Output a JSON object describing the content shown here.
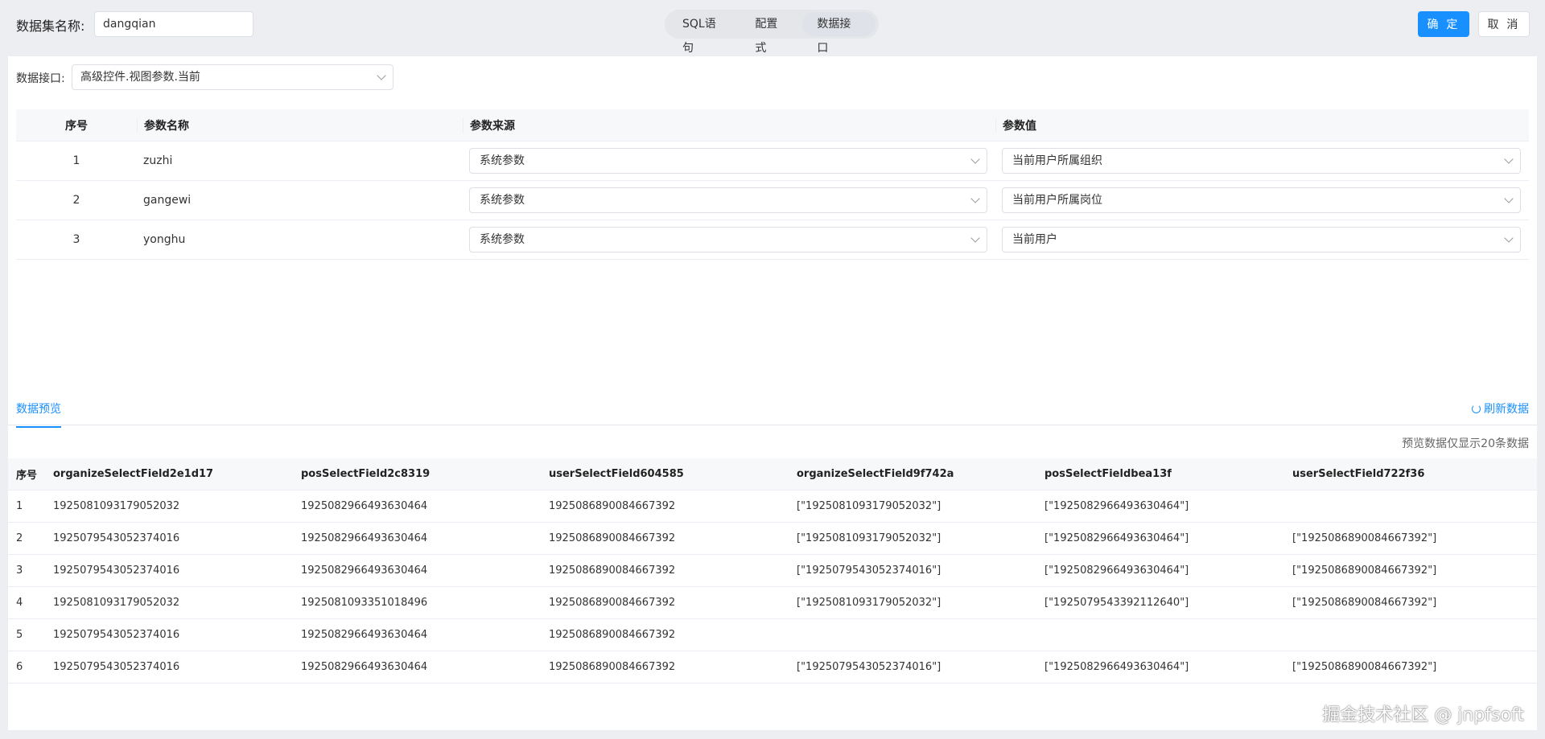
{
  "header": {
    "name_label": "数据集名称:",
    "name_value": "dangqian",
    "tabs": [
      "SQL语句",
      "配置式",
      "数据接口"
    ],
    "confirm": "确 定",
    "cancel": "取 消"
  },
  "api": {
    "label": "数据接口:",
    "value": "高级控件.视图参数.当前"
  },
  "params": {
    "headers": [
      "序号",
      "参数名称",
      "参数来源",
      "参数值"
    ],
    "rows": [
      {
        "no": "1",
        "name": "zuzhi",
        "source": "系统参数",
        "value": "当前用户所属组织"
      },
      {
        "no": "2",
        "name": "gangewi",
        "source": "系统参数",
        "value": "当前用户所属岗位"
      },
      {
        "no": "3",
        "name": "yonghu",
        "source": "系统参数",
        "value": "当前用户"
      }
    ]
  },
  "preview": {
    "tab": "数据预览",
    "refresh": "刷新数据",
    "note": "预览数据仅显示20条数据",
    "headers": [
      "序号",
      "organizeSelectField2e1d17",
      "posSelectField2c8319",
      "userSelectField604585",
      "organizeSelectField9f742a",
      "posSelectFieldbea13f",
      "userSelectField722f36"
    ],
    "rows": [
      [
        "1",
        "1925081093179052032",
        "1925082966493630464",
        "1925086890084667392",
        "[\"1925081093179052032\"]",
        "[\"1925082966493630464\"]",
        ""
      ],
      [
        "2",
        "1925079543052374016",
        "1925082966493630464",
        "1925086890084667392",
        "[\"1925081093179052032\"]",
        "[\"1925082966493630464\"]",
        "[\"1925086890084667392\"]"
      ],
      [
        "3",
        "1925079543052374016",
        "1925082966493630464",
        "1925086890084667392",
        "[\"1925079543052374016\"]",
        "[\"1925082966493630464\"]",
        "[\"1925086890084667392\"]"
      ],
      [
        "4",
        "1925081093179052032",
        "1925081093351018496",
        "1925086890084667392",
        "[\"1925081093179052032\"]",
        "[\"1925079543392112640\"]",
        "[\"1925086890084667392\"]"
      ],
      [
        "5",
        "1925079543052374016",
        "1925082966493630464",
        "1925086890084667392",
        "",
        "",
        ""
      ],
      [
        "6",
        "1925079543052374016",
        "1925082966493630464",
        "1925086890084667392",
        "[\"1925079543052374016\"]",
        "[\"1925082966493630464\"]",
        "[\"1925086890084667392\"]"
      ]
    ]
  },
  "watermark": "掘金技术社区 @ jnpfsoft"
}
